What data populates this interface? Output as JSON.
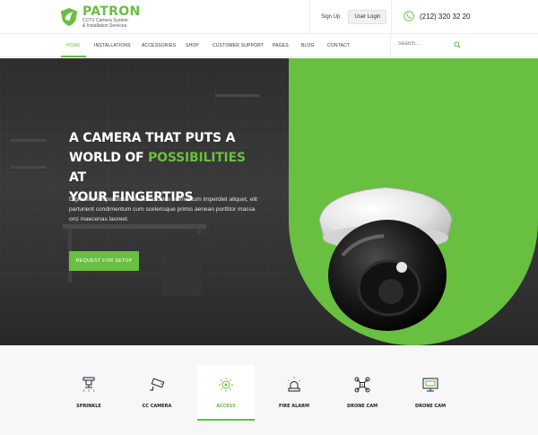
{
  "brand": {
    "name": "PATRON",
    "tagline_line1": "CCTV Camera System",
    "tagline_line2": "& Installation Services",
    "logo_icon": "shield-leaf-icon",
    "accent_color": "#69bf40"
  },
  "header": {
    "signup_label": "Sign Up",
    "login_label": "User Login",
    "phone": "(212) 320 32 20",
    "phone_icon": "phone-icon"
  },
  "nav": {
    "items": [
      {
        "label": "HOME",
        "active": true
      },
      {
        "label": "INSTALLATIONS",
        "active": false
      },
      {
        "label": "ACCESSORIES",
        "active": false
      },
      {
        "label": "SHOP",
        "active": false
      },
      {
        "label": "CUSTOMER SUPPORT",
        "active": false
      },
      {
        "label": "PAGES",
        "active": false
      },
      {
        "label": "BLOG",
        "active": false
      },
      {
        "label": "CONTACT",
        "active": false
      }
    ],
    "search_placeholder": "Search..."
  },
  "hero": {
    "headline_line1": "A CAMERA THAT PUTS A",
    "headline_line2_prefix": "WORLD OF ",
    "headline_highlight": "POSSIBILITIES",
    "headline_line2_suffix": " AT",
    "headline_line3": "YOUR FINGERTIPS",
    "description": "Dignissim suspendisse iaculis ridiculus elementum imperdiet aliquet, elit parturient condimentum cum scelerisque primis aenean porttitor massa orci maecenas laoreet.",
    "cta_label": "REQUEST FOR SETUP"
  },
  "services": [
    {
      "label": "SPRINKLE",
      "icon": "sprinkler-icon",
      "active": false
    },
    {
      "label": "CC CAMERA",
      "icon": "cctv-camera-icon",
      "active": false
    },
    {
      "label": "ACCESS",
      "icon": "access-sensor-icon",
      "active": true
    },
    {
      "label": "FIRE ALARM",
      "icon": "fire-alarm-icon",
      "active": false
    },
    {
      "label": "DRONE CAM",
      "icon": "drone-icon",
      "active": false
    },
    {
      "label": "DRONE CAM",
      "icon": "monitor-icon",
      "active": false
    }
  ]
}
